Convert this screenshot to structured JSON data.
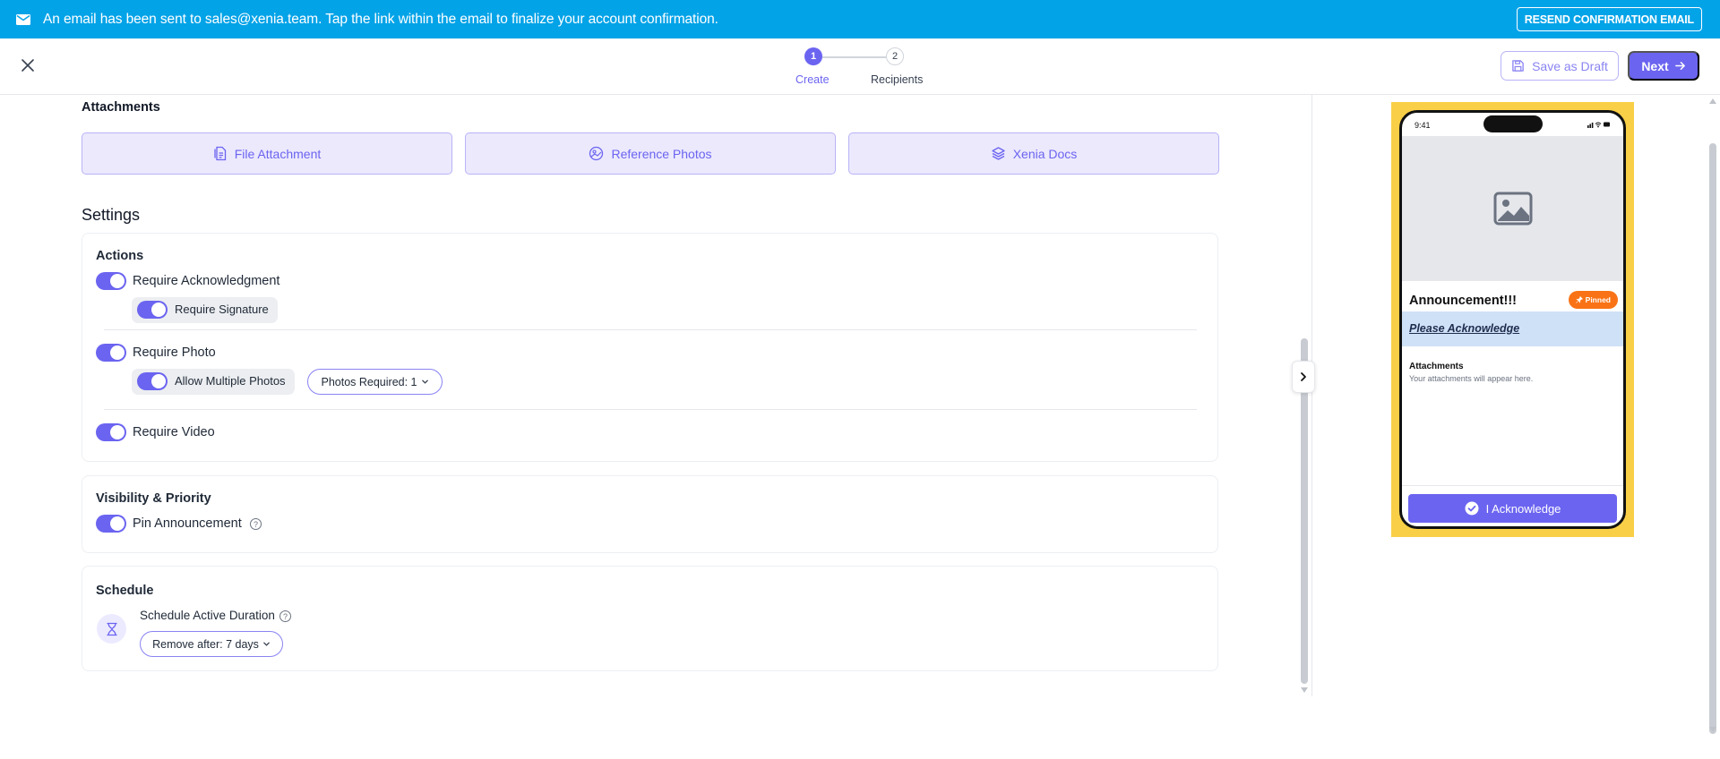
{
  "banner": {
    "message": "An email has been sent to sales@xenia.team. Tap the link within the email to finalize your account confirmation.",
    "resend_label": "RESEND CONFIRMATION EMAIL"
  },
  "header": {
    "steps": [
      {
        "number": "1",
        "label": "Create"
      },
      {
        "number": "2",
        "label": "Recipients"
      }
    ],
    "save_draft_label": "Save as Draft",
    "next_label": "Next"
  },
  "attachments": {
    "title": "Attachments",
    "buttons": [
      {
        "label": "File Attachment",
        "icon": "file-attachment-icon"
      },
      {
        "label": "Reference Photos",
        "icon": "reference-photos-icon"
      },
      {
        "label": "Xenia Docs",
        "icon": "xenia-docs-icon"
      }
    ]
  },
  "settings": {
    "title": "Settings",
    "actions": {
      "title": "Actions",
      "require_ack": "Require Acknowledgment",
      "require_signature": "Require Signature",
      "require_photo": "Require Photo",
      "allow_multiple_photos": "Allow Multiple Photos",
      "photos_required": "Photos Required: 1",
      "require_video": "Require Video"
    },
    "visibility": {
      "title": "Visibility & Priority",
      "pin_announcement": "Pin Announcement"
    },
    "schedule": {
      "title": "Schedule",
      "active_duration_label": "Schedule Active Duration",
      "remove_after": "Remove after: 7 days"
    }
  },
  "preview": {
    "time": "9:41",
    "title": "Announcement!!!",
    "pinned_label": "Pinned",
    "ack_link": "Please Acknowledge",
    "attachments_title": "Attachments",
    "attachments_empty": "Your attachments will appear here.",
    "ack_button": "I Acknowledge"
  },
  "colors": {
    "banner": "#03a3e8",
    "accent": "#6b64f0",
    "pinned": "#f97316",
    "preview_frame": "#f9cf48"
  }
}
